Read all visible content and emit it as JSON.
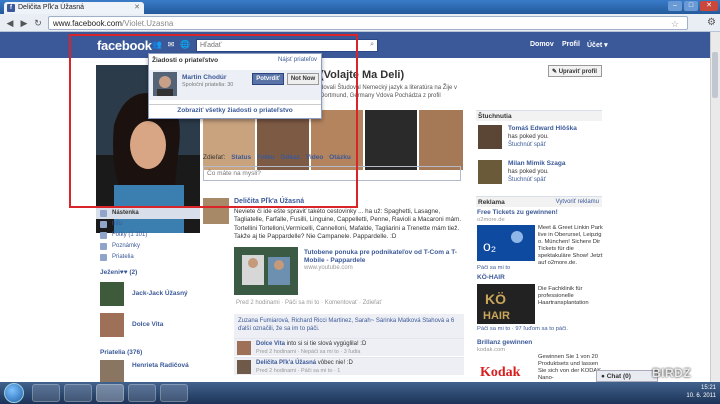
{
  "browser": {
    "tab_title": "Deličita Pľk'a Úžasná",
    "url_domain": "www.facebook.com",
    "url_path": "/Violet.Uzasna"
  },
  "fb_header": {
    "logo": "facebook",
    "search_placeholder": "Hľadať",
    "links": [
      "Domov",
      "Profil",
      "Účet ▾"
    ]
  },
  "profile": {
    "name": "(Volajte Ma Deli)",
    "info_line": "dovali   Študoval Nemecký jazyk a literatúra na Žije v Dortmund, Germany   Vdova   Pochádza z profil",
    "edit_button": "Upraviť profil",
    "share_label": "Zdieľať:",
    "share_options": [
      "Status",
      "Fotku",
      "Odkaz",
      "Video",
      "Otázku"
    ],
    "status_placeholder": "Čo máte na mysli?"
  },
  "popup": {
    "title": "Žiadosti o priateľstvo",
    "find_friends": "Nájsť priateľov",
    "request_name": "Martin Chodúr",
    "mutual": "Spoloční priatelia: 30",
    "confirm": "Potvrdiť",
    "not_now": "Not Now",
    "show_all": "Zobraziť všetky žiadosti o priateľstvo"
  },
  "left_nav": {
    "items": [
      "Nástenka",
      "Info",
      "Fotky (1 101)",
      "Poznámky",
      "Priatelia"
    ],
    "friends_title": "Ježeni♥♥ (2)",
    "friends": [
      "Jack-Jack Úžasný",
      "Dolce Vita"
    ],
    "priatelia_title": "Priatelia (376)",
    "priatelia_first": "Henrieta Radičová"
  },
  "post": {
    "author": "Deličita Pľk'a Úžasná",
    "text": "Neviete či ide ešte spraviť takéto cestovinky ... ha už: Spaghetti, Lasagne, Tagliatelle, Farfalle, Fusilli, Linguine, Cappelletti, Penne, Ravioli a Macaroni mám. Tortellini Tortelloni,Vermicelli, Cannelloni, Mafalde, Tagliarini a Trenette mám tiež. Takže aj tie Pappardelle? Nie Campanele. Pappardelle. :D",
    "link_title": "Tutobene ponuka pre podnikateľov od T-Com a T-Mobile - Pappardele",
    "link_url": "www.youtube.com",
    "meta": "Pred 2 hodinami · Páči sa mi to · Komentovať · Zdieľať",
    "likes": "Zuzana Fumiarová, Richard Ricci Martinez, Sarah~ Sárinka Matková Stahová a 6 ďalší označili, že sa im to páči.",
    "comments": [
      {
        "name": "Dolce Vita",
        "text": "into si si tie slová vygúglila! :D",
        "meta": "Pred 2 hodinami · Nepáči sa mi to · 3 ľudia"
      },
      {
        "name": "Deličita Pľk'a Úžasná",
        "text": "vôbec nie! :D",
        "meta": "Pred 2 hodinami · Páči sa mi to · 1"
      }
    ]
  },
  "right": {
    "pokes_title": "Štuchnutia",
    "pokes": [
      {
        "name": "Tomáš Edward Hlôška",
        "text": "has poked you.",
        "action": "Štuchnúť späť"
      },
      {
        "name": "Milan Mimik Szaga",
        "text": "has poked you.",
        "action": "Štuchnúť späť"
      }
    ],
    "ads_title": "Reklama",
    "ads_create": "Vytvoriť reklamu",
    "ads": [
      {
        "title": "Free Tickets zu gewinnen!",
        "url": "o2more.de",
        "text": "Meet & Greet Linkin Park live in Oberursel, Leipzig o. München! Sichere Dir Tickets für die spektakuläre Show! Jetzt auf o2more.de.",
        "like": "Páči sa mi to"
      },
      {
        "title": "KÖ-HAIR",
        "url": "",
        "text": "Die Fachklinik für professionelle Haartransplantation",
        "like": "Páči sa mi to · 97 ľuďom sa to páči."
      },
      {
        "title": "Brillanz gewinnen",
        "url": "kodak.com",
        "text": "Gewinnen Sie 1 von 20 Produktsets und lassen Sie sich von der KODAK Nano-",
        "like": ""
      }
    ]
  },
  "chat": "Chat (0)",
  "tray": {
    "time": "15:21",
    "date": "10. 6. 2011"
  },
  "watermark": "BIRDZ"
}
